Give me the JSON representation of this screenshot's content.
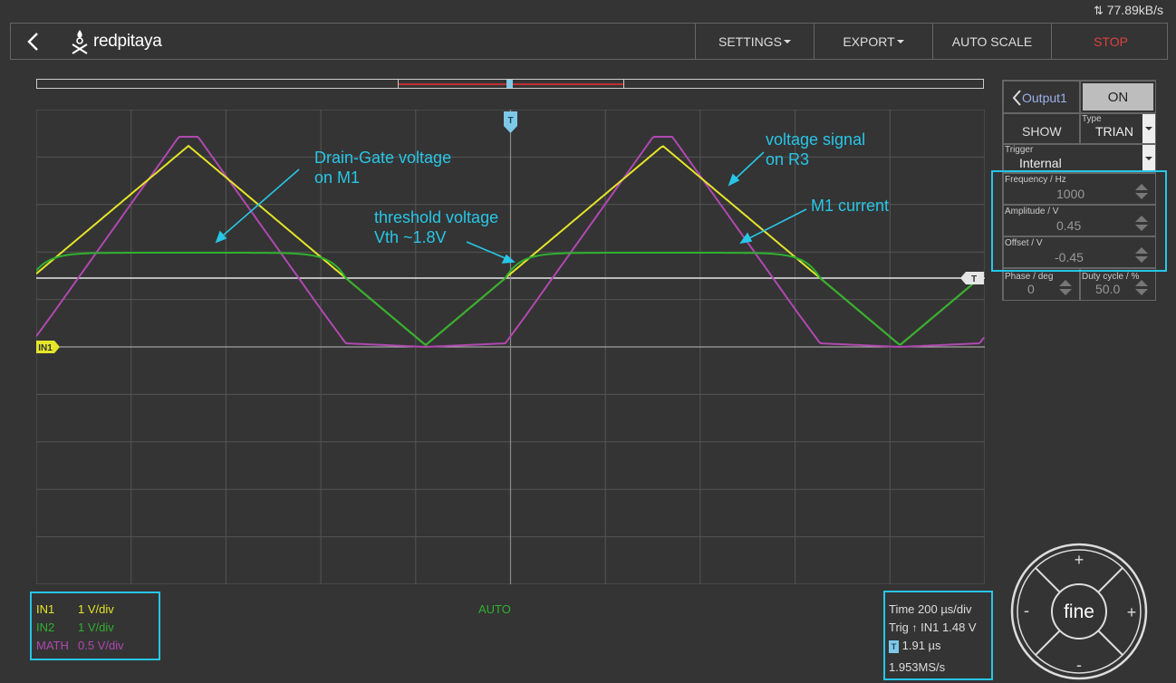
{
  "status": {
    "net_speed": "77.89kB/s"
  },
  "header": {
    "logo_text": "redpitaya",
    "menu": {
      "settings": "SETTINGS",
      "export": "EXPORT",
      "autoscale": "AUTO SCALE",
      "stop": "STOP"
    }
  },
  "colors": {
    "in1": "#e5e52a",
    "in2": "#2fb02f",
    "math": "#b048b0",
    "annotation": "#27c6e6",
    "stop": "#e04040"
  },
  "markers": {
    "trigger": "T",
    "in1": "IN1",
    "trigger_level": "T"
  },
  "output_panel": {
    "title": "Output1",
    "on_button": "ON",
    "show_button": "SHOW",
    "type_label": "Type",
    "type_value": "TRIAN",
    "trigger_label": "Trigger",
    "trigger_value": "Internal",
    "frequency_label": "Frequency / Hz",
    "frequency_value": "1000",
    "amplitude_label": "Amplitude / V",
    "amplitude_value": "0.45",
    "offset_label": "Offset / V",
    "offset_value": "-0.45",
    "phase_label": "Phase / deg",
    "phase_value": "0",
    "duty_label": "Duty cycle / %",
    "duty_value": "50.0"
  },
  "annotations": {
    "drain_gate_1": "Drain-Gate voltage",
    "drain_gate_2": "on M1",
    "threshold_1": "threshold voltage",
    "threshold_2": "Vth ~1.8V",
    "voltage_r3_1": "voltage signal",
    "voltage_r3_2": "on R3",
    "m1_current": "M1 current"
  },
  "channels": [
    {
      "name": "IN1",
      "scale": "1 V/div"
    },
    {
      "name": "IN2",
      "scale": "1 V/div"
    },
    {
      "name": "MATH",
      "scale": "0.5 V/div"
    }
  ],
  "trigger_mode": "AUTO",
  "timebase": {
    "time": "Time 200 µs/div",
    "trig": "Trig",
    "trig_source": "IN1 1.48 V",
    "delay": "1.91 µs",
    "sample_rate": "1.953MS/s"
  },
  "nav": {
    "center": "fine",
    "plus": "+",
    "minus": "-"
  }
}
